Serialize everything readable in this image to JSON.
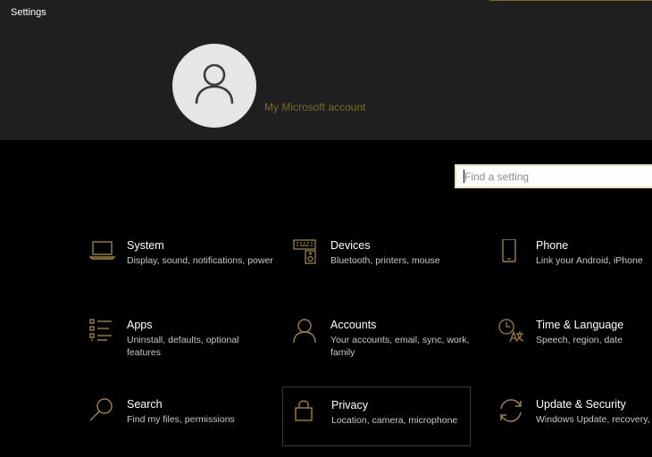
{
  "window": {
    "title": "Settings"
  },
  "account": {
    "link_label": "My Microsoft account"
  },
  "search": {
    "placeholder": "Find a setting"
  },
  "colors": {
    "header_bg": "#1f1f1f",
    "page_bg": "#000000",
    "icon_accent": "#9b8146",
    "account_link": "#7a6a2a"
  },
  "categories": [
    {
      "name": "System",
      "description": "Display, sound, notifications, power",
      "icon": "laptop-icon"
    },
    {
      "name": "Devices",
      "description": "Bluetooth, printers, mouse",
      "icon": "keyboard-speaker-icon"
    },
    {
      "name": "Phone",
      "description": "Link your Android, iPhone",
      "icon": "phone-icon"
    },
    {
      "name": "Apps",
      "description": "Uninstall, defaults, optional features",
      "icon": "apps-list-icon"
    },
    {
      "name": "Accounts",
      "description": "Your accounts, email, sync, work, family",
      "icon": "person-icon"
    },
    {
      "name": "Time & Language",
      "description": "Speech, region, date",
      "icon": "time-language-icon"
    },
    {
      "name": "Search",
      "description": "Find my files, permissions",
      "icon": "magnifier-icon"
    },
    {
      "name": "Privacy",
      "description": "Location, camera, microphone",
      "icon": "lock-icon"
    },
    {
      "name": "Update & Security",
      "description": "Windows Update, recovery, backup",
      "icon": "sync-arrows-icon"
    }
  ]
}
